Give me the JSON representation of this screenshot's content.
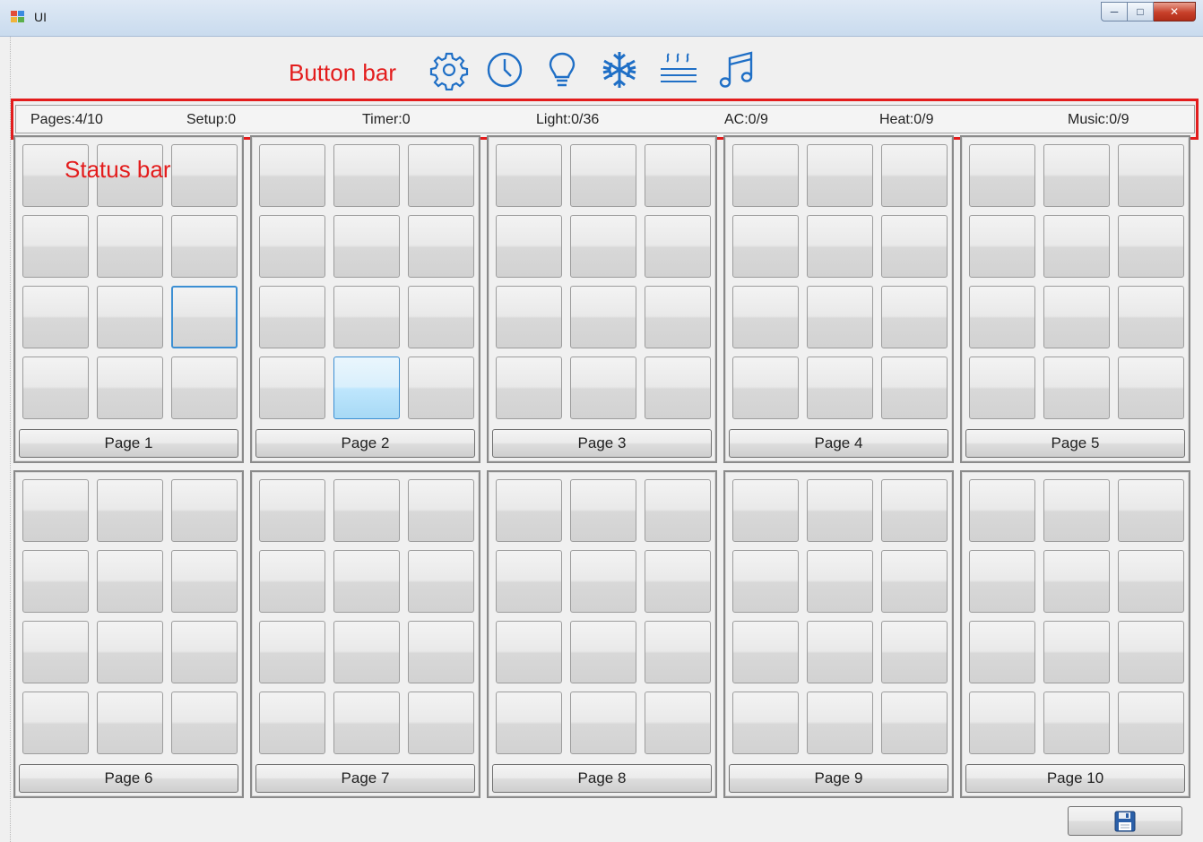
{
  "window": {
    "title": "UI"
  },
  "annotations": {
    "button_bar": "Button bar",
    "status_bar": "Status bar"
  },
  "toolbar": {
    "icons": [
      "gear-icon",
      "clock-icon",
      "lightbulb-icon",
      "snowflake-icon",
      "heat-icon",
      "music-icon"
    ],
    "accent_color": "#1f6fc6"
  },
  "status": {
    "pages": "Pages:4/10",
    "setup": "Setup:0",
    "timer": "Timer:0",
    "light": "Light:0/36",
    "ac": "AC:0/9",
    "heat": "Heat:0/9",
    "music": "Music:0/9"
  },
  "pages": [
    {
      "label": "Page 1"
    },
    {
      "label": "Page 2"
    },
    {
      "label": "Page 3"
    },
    {
      "label": "Page 4"
    },
    {
      "label": "Page 5"
    },
    {
      "label": "Page 6"
    },
    {
      "label": "Page 7"
    },
    {
      "label": "Page 8"
    },
    {
      "label": "Page 9"
    },
    {
      "label": "Page 10"
    }
  ],
  "highlight_color": "#e31c1c",
  "save_icon": "floppy-disk-icon"
}
